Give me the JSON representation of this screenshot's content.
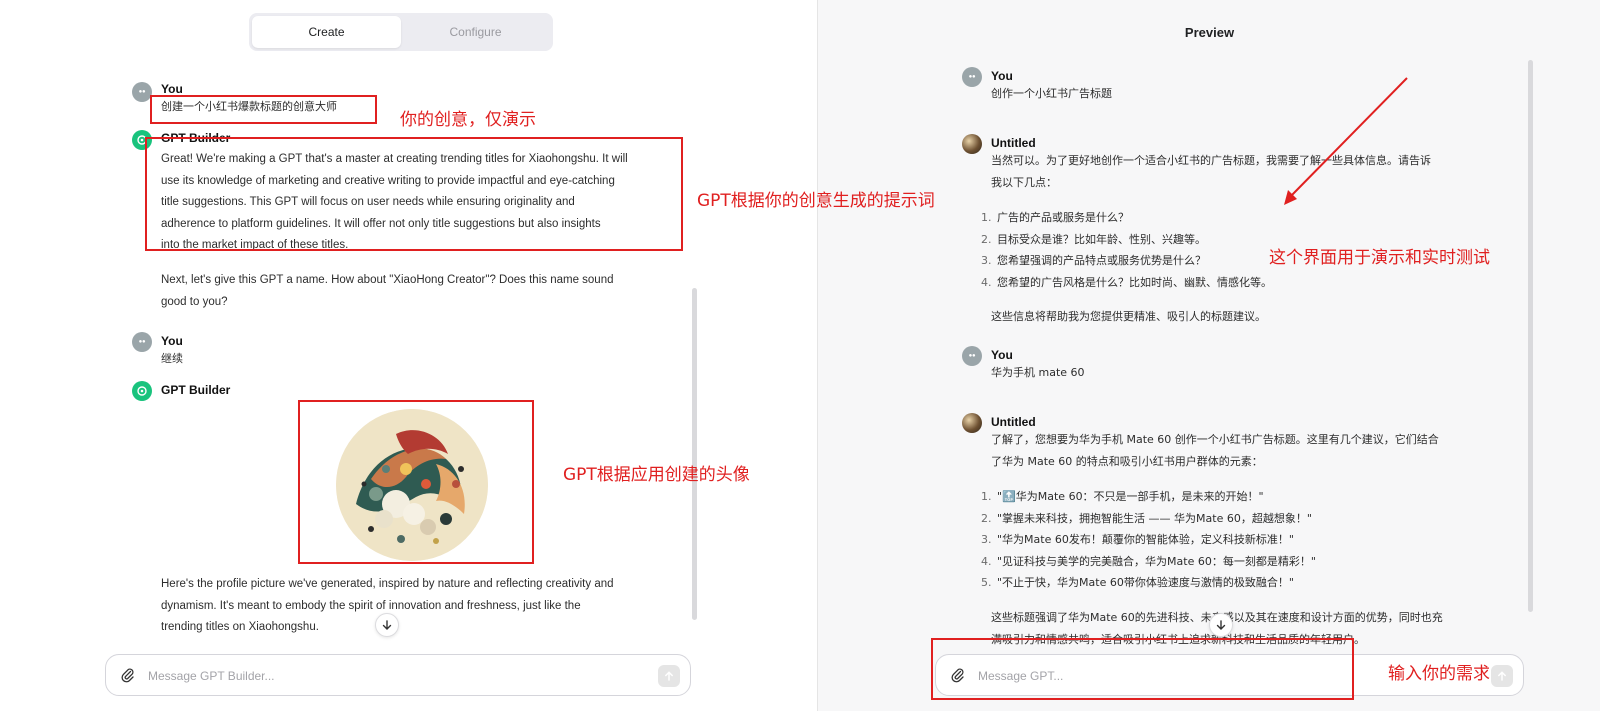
{
  "left": {
    "tabs": [
      {
        "label": "Create",
        "active": true
      },
      {
        "label": "Configure",
        "active": false
      }
    ],
    "messages": {
      "user1": {
        "sender": "You",
        "text": "创建一个小红书爆款标题的创意大师"
      },
      "gpt1": {
        "sender": "GPT Builder",
        "lines": [
          "Great! We're making a GPT that's a master at creating trending titles for Xiaohongshu. It will",
          "use its knowledge of marketing and creative writing to provide impactful and eye-catching",
          "title suggestions. This GPT will focus on user needs while ensuring originality and",
          "adherence to platform guidelines. It will offer not only title suggestions but also insights",
          "into the market impact of these titles."
        ],
        "followup": [
          "Next, let's give this GPT a name. How about \"XiaoHong Creator\"? Does this name sound",
          "good to you?"
        ]
      },
      "user2": {
        "sender": "You",
        "text": "继续"
      },
      "gpt2": {
        "sender": "GPT Builder",
        "caption": [
          "Here's the profile picture we've generated, inspired by nature and reflecting creativity and",
          "dynamism. It's meant to embody the spirit of innovation and freshness, just like the",
          "trending titles on Xiaohongshu."
        ]
      }
    },
    "composer": {
      "placeholder": "Message GPT Builder..."
    }
  },
  "right": {
    "title": "Preview",
    "messages": {
      "user1": {
        "sender": "You",
        "text": "创作一个小红书广告标题"
      },
      "bot1": {
        "sender": "Untitled",
        "intro": [
          "当然可以。为了更好地创作一个适合小红书的广告标题，我需要了解一些具体信息。请告诉",
          "我以下几点："
        ],
        "items": [
          {
            "num": "1.",
            "text": "广告的产品或服务是什么？"
          },
          {
            "num": "2.",
            "text": "目标受众是谁？比如年龄、性别、兴趣等。"
          },
          {
            "num": "3.",
            "text": "您希望强调的产品特点或服务优势是什么？"
          },
          {
            "num": "4.",
            "text": "您希望的广告风格是什么？比如时尚、幽默、情感化等。"
          }
        ],
        "outro": "这些信息将帮助我为您提供更精准、吸引人的标题建议。"
      },
      "user2": {
        "sender": "You",
        "text": "华为手机 mate 60"
      },
      "bot2": {
        "sender": "Untitled",
        "intro": [
          "了解了，您想要为华为手机 Mate 60 创作一个小红书广告标题。这里有几个建议，它们结合",
          "了华为 Mate 60 的特点和吸引小红书用户群体的元素："
        ],
        "items": [
          {
            "num": "1.",
            "text": "\"🔝华为Mate 60：不只是一部手机，是未来的开始！\""
          },
          {
            "num": "2.",
            "text": "\"掌握未来科技，拥抱智能生活 —— 华为Mate 60，超越想象！\""
          },
          {
            "num": "3.",
            "text": "\"华为Mate 60发布！颠覆你的智能体验，定义科技新标准！\""
          },
          {
            "num": "4.",
            "text": "\"见证科技与美学的完美融合，华为Mate 60：每一刻都是精彩！\""
          },
          {
            "num": "5.",
            "text": "\"不止于快，华为Mate 60带你体验速度与激情的极致融合！\""
          }
        ],
        "trailing": [
          "这些标题强调了华为Mate 60的先进科技、未来感以及其在速度和设计方面的优势，同时也充",
          "满吸引力和情感共鸣，适合吸引小红书上追求新科技和生活品质的年轻用户。"
        ]
      }
    },
    "composer": {
      "placeholder": "Message GPT..."
    }
  },
  "annotations": {
    "idea": "你的创意，仅演示",
    "prompt": "GPT根据你的创意生成的提示词",
    "avatar": "GPT根据应用创建的头像",
    "preview": "这个界面用于演示和实时测试",
    "input": "输入你的需求"
  },
  "colors": {
    "annotation_red": "#e02020",
    "gpt_builder_green": "#19c37d",
    "preview_bg": "#f7f7f8"
  }
}
